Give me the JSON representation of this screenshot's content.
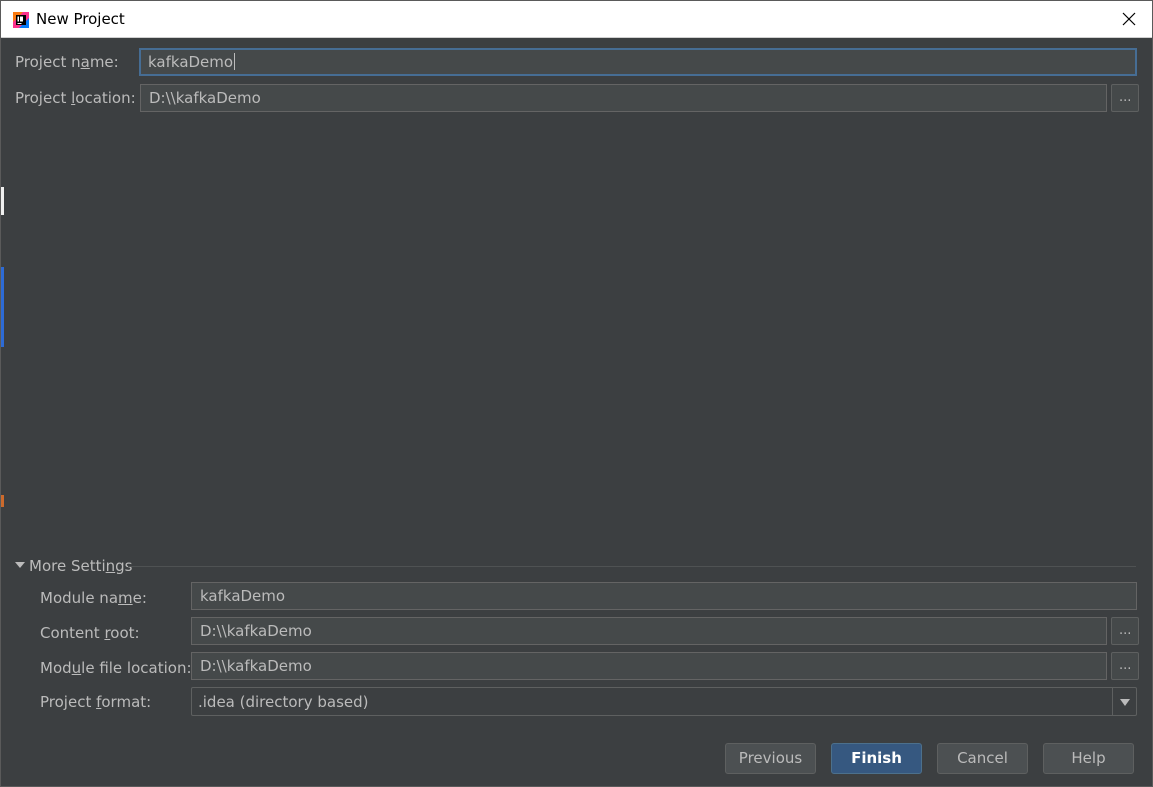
{
  "window": {
    "title": "New Project",
    "app_icon": "intellij-idea-icon",
    "close_icon": "close-icon"
  },
  "project": {
    "name_label_pre": "Project n",
    "name_label_ul": "a",
    "name_label_post": "me:",
    "name_value": "kafkaDemo",
    "location_label_pre": "Project ",
    "location_label_ul": "l",
    "location_label_post": "ocation:",
    "location_value": "D:\\\\kafkaDemo",
    "browse_label": "..."
  },
  "more_settings": {
    "label_pre": "More Setti",
    "label_ul": "n",
    "label_post": "gs",
    "expanded": true,
    "module_name_label_pre": "Module na",
    "module_name_label_ul": "m",
    "module_name_label_post": "e:",
    "module_name_value": "kafkaDemo",
    "content_root_label_pre": "Content ",
    "content_root_label_ul": "r",
    "content_root_label_post": "oot:",
    "content_root_value": "D:\\\\kafkaDemo",
    "module_file_label_pre": "Mod",
    "module_file_label_ul": "u",
    "module_file_label_post": "le file location:",
    "module_file_value": "D:\\\\kafkaDemo",
    "project_format_label_pre": "Project ",
    "project_format_label_ul": "f",
    "project_format_label_post": "ormat:",
    "project_format_value": ".idea (directory based)"
  },
  "buttons": {
    "previous": "Previous",
    "finish": "Finish",
    "cancel": "Cancel",
    "help": "Help"
  },
  "colors": {
    "background": "#3c3f41",
    "field_bg": "#45494a",
    "focus_border": "#466d94",
    "default_button": "#365880",
    "text": "#bbbbbb"
  }
}
